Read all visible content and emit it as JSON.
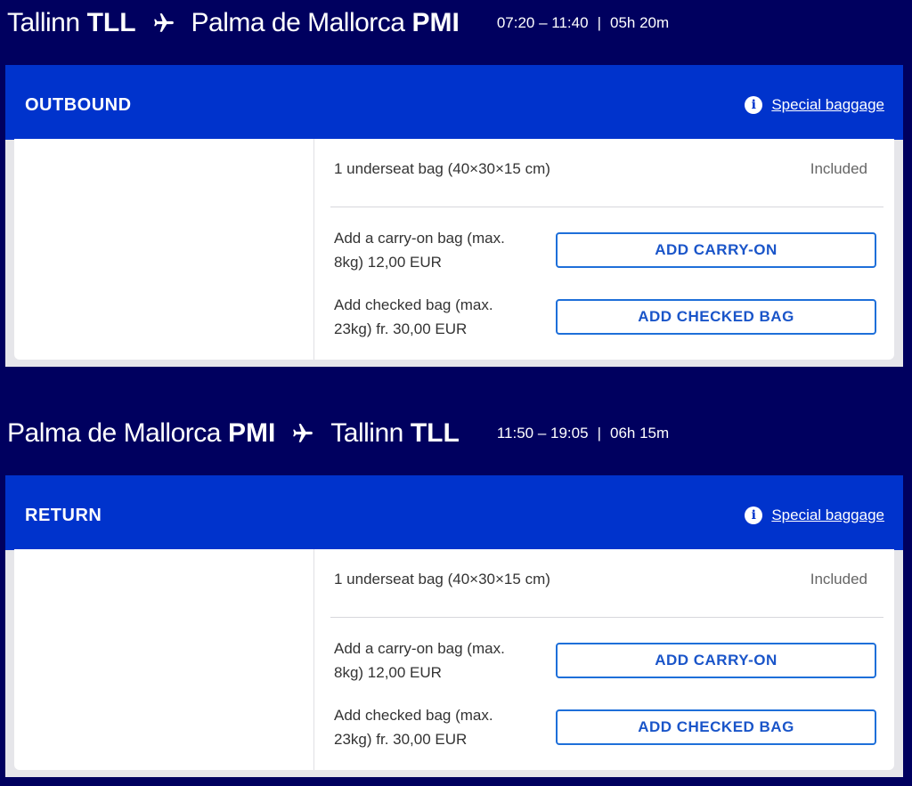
{
  "outbound": {
    "from_city": "Tallinn",
    "from_code": "TLL",
    "to_city": "Palma de Mallorca",
    "to_code": "PMI",
    "time_range": "07:20 – 11:40",
    "duration": "05h 20m",
    "section_label": "OUTBOUND",
    "special_baggage_label": "Special baggage",
    "included_item": "1 underseat bag (40×30×15 cm)",
    "included_status": "Included",
    "carry_on_desc": "Add a carry-on bag (max. 8kg) 12,00 EUR",
    "carry_on_button": "ADD CARRY-ON",
    "checked_desc": "Add checked bag (max. 23kg) fr. 30,00 EUR",
    "checked_button": "ADD CHECKED BAG"
  },
  "return": {
    "from_city": "Palma de Mallorca",
    "from_code": "PMI",
    "to_city": "Tallinn",
    "to_code": "TLL",
    "time_range": "11:50 – 19:05",
    "duration": "06h 15m",
    "section_label": "RETURN",
    "special_baggage_label": "Special baggage",
    "included_item": "1 underseat bag (40×30×15 cm)",
    "included_status": "Included",
    "carry_on_desc": "Add a carry-on bag (max. 8kg) 12,00 EUR",
    "carry_on_button": "ADD CARRY-ON",
    "checked_desc": "Add checked bag (max. 23kg) fr. 30,00 EUR",
    "checked_button": "ADD CHECKED BAG"
  },
  "separator": "|",
  "icons": {
    "plane": "plane-icon",
    "info": "info-icon"
  },
  "colors": {
    "background": "#00005f",
    "section_header": "#0033cc",
    "button_border": "#1e6fd9",
    "button_text": "#1a55c9"
  }
}
